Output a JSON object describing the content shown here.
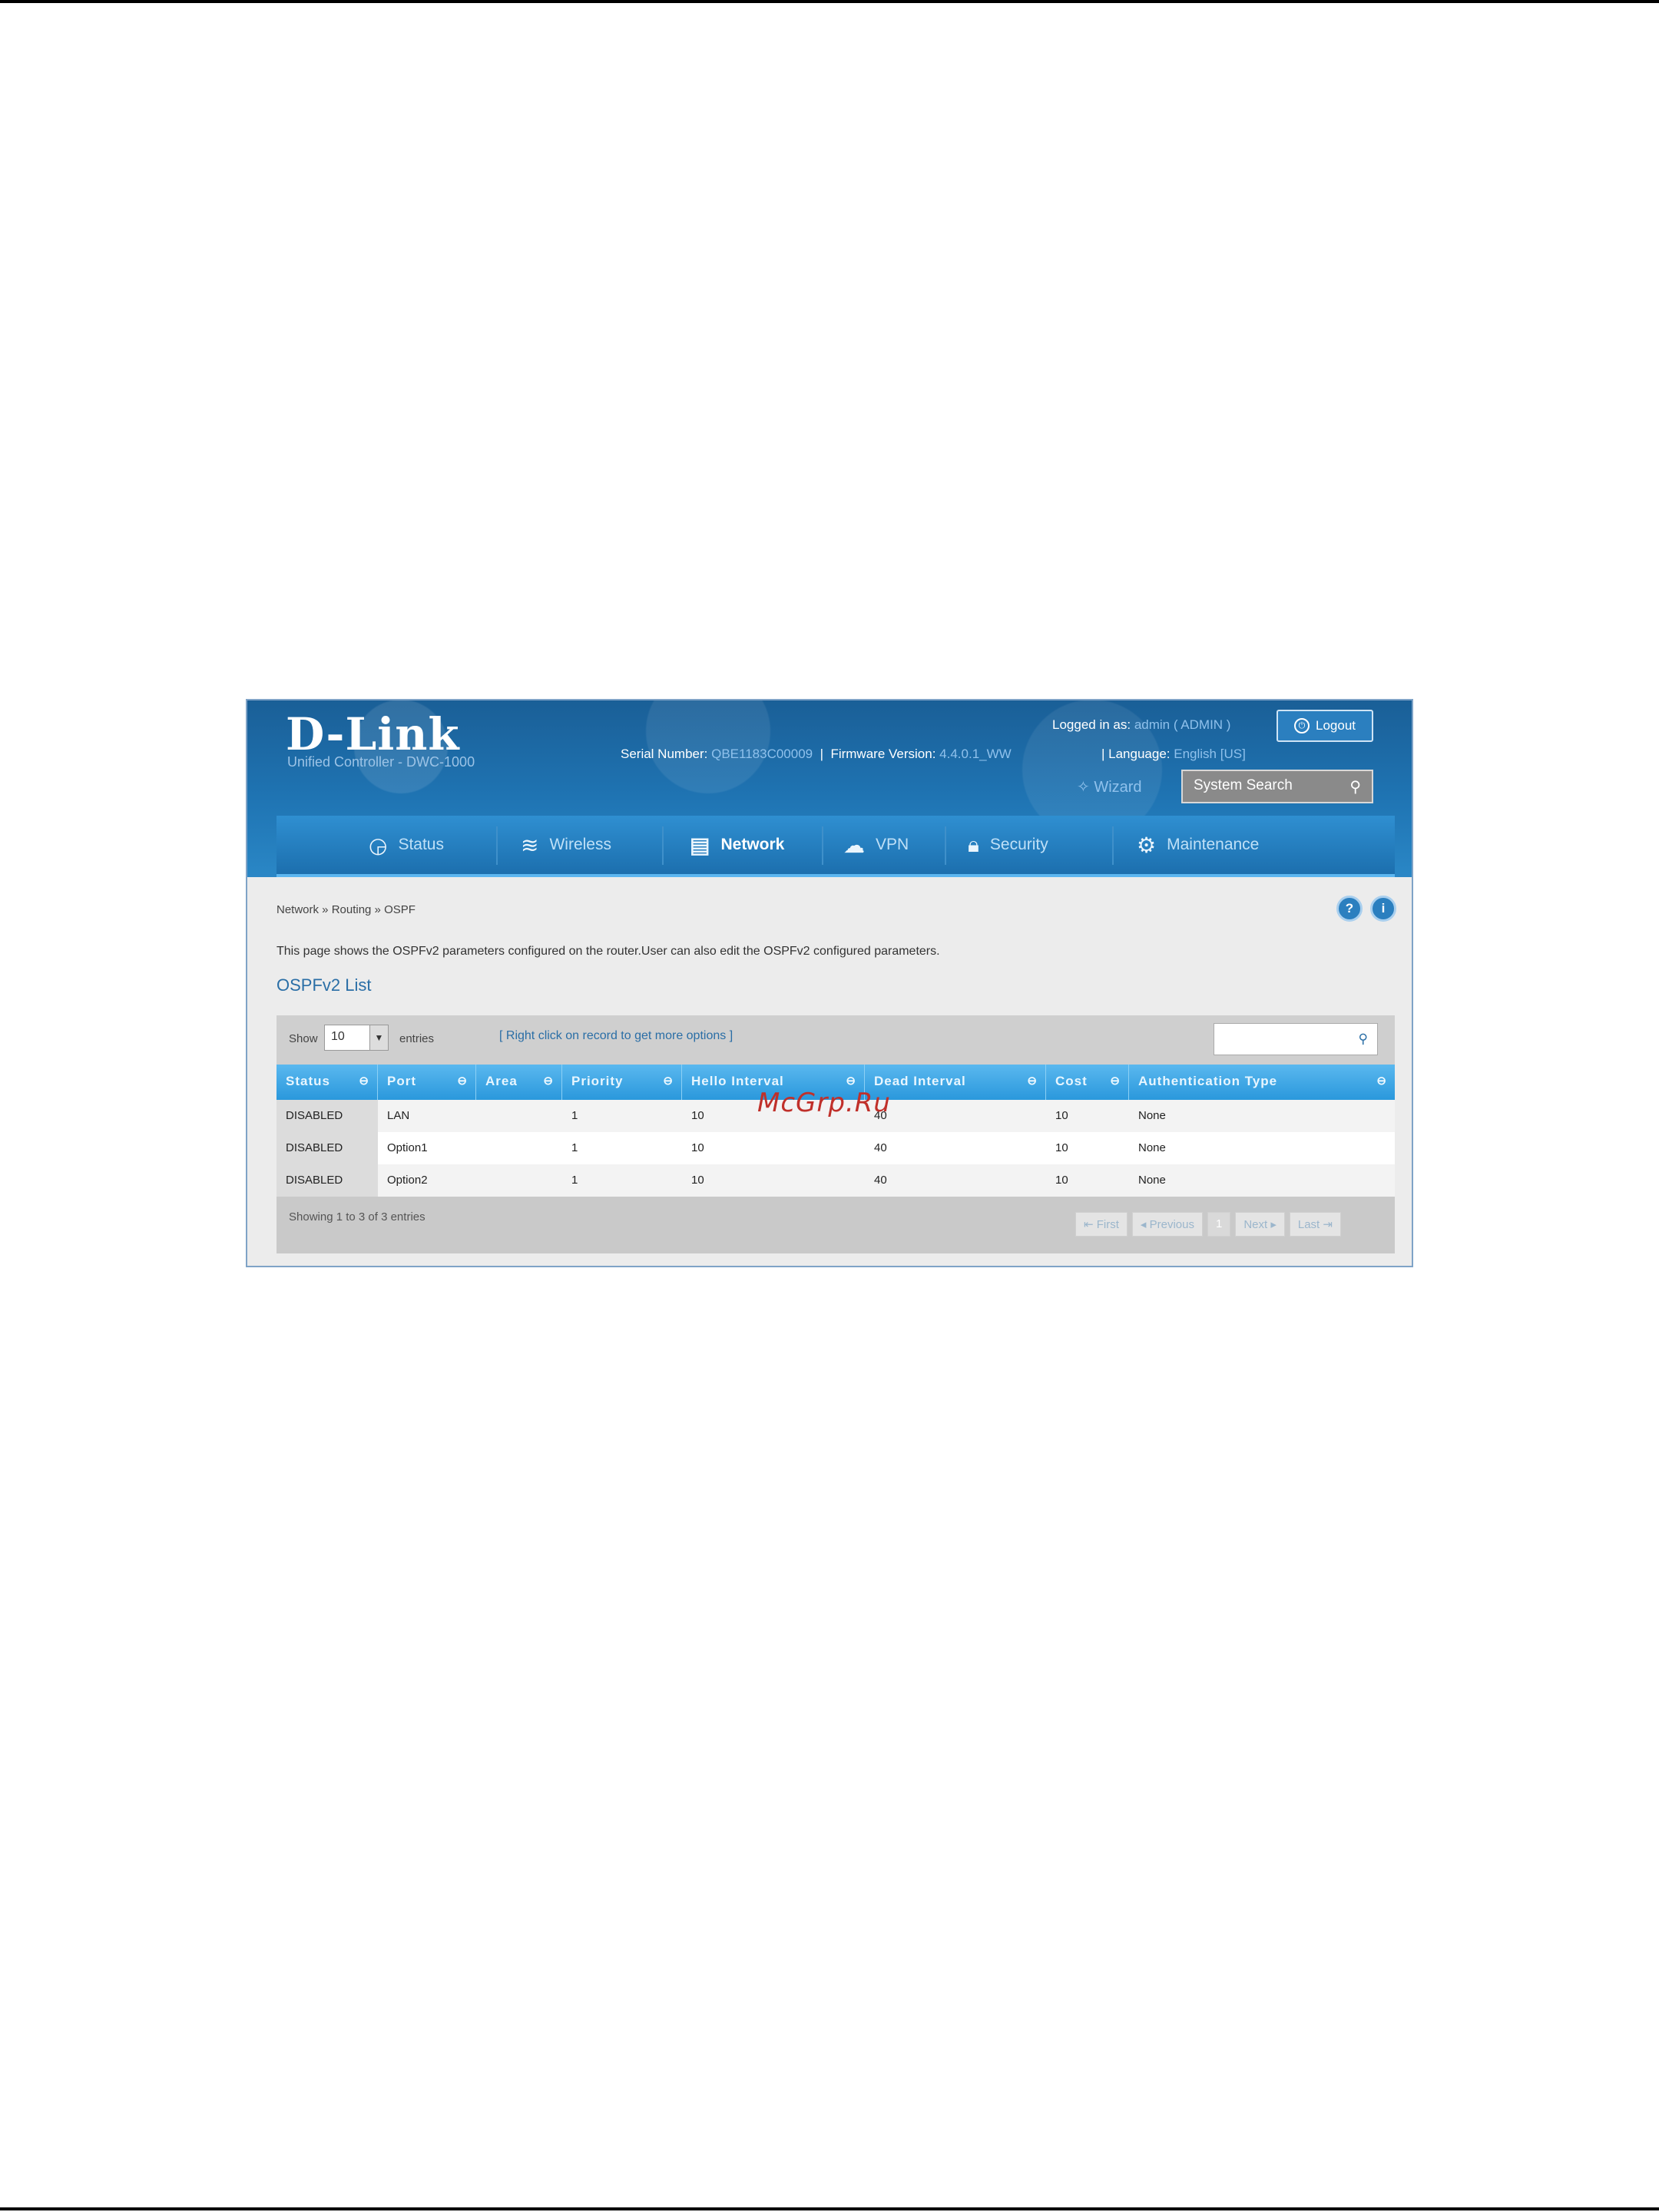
{
  "watermark": "McGrp.Ru",
  "header": {
    "brand": "D-Link",
    "subtitle": "Unified Controller - DWC-1000",
    "serial_label": "Serial Number:",
    "serial_value": "QBE1183C00009",
    "firmware_label": "Firmware Version:",
    "firmware_value": "4.4.0.1_WW",
    "logged_in_label": "Logged in as:",
    "logged_in_value": "admin ( ADMIN )",
    "language_label": "Language:",
    "language_value": "English [US]",
    "logout_label": "Logout",
    "wizard_label": "Wizard",
    "system_search_placeholder": "System Search"
  },
  "nav": {
    "items": [
      {
        "label": "Status",
        "icon": "gauge-icon",
        "active": false
      },
      {
        "label": "Wireless",
        "icon": "wifi-icon",
        "active": false
      },
      {
        "label": "Network",
        "icon": "network-icon",
        "active": true
      },
      {
        "label": "VPN",
        "icon": "cloud-icon",
        "active": false
      },
      {
        "label": "Security",
        "icon": "lock-icon",
        "active": false
      },
      {
        "label": "Maintenance",
        "icon": "gears-icon",
        "active": false
      }
    ]
  },
  "breadcrumb": "Network  »  Routing  »  OSPF",
  "description": "This page shows the OSPFv2 parameters configured on the router.User can also edit the OSPFv2 configured parameters.",
  "list_title": "OSPFv2 List",
  "table": {
    "show_label": "Show",
    "show_value": "10",
    "entries_label": "entries",
    "right_click_hint": "[ Right click on record to get more options ]",
    "columns": [
      "Status",
      "Port",
      "Area",
      "Priority",
      "Hello Interval",
      "Dead Interval",
      "Cost",
      "Authentication Type"
    ],
    "rows": [
      [
        "DISABLED",
        "LAN",
        "",
        "1",
        "10",
        "40",
        "10",
        "None"
      ],
      [
        "DISABLED",
        "Option1",
        "",
        "1",
        "10",
        "40",
        "10",
        "None"
      ],
      [
        "DISABLED",
        "Option2",
        "",
        "1",
        "10",
        "40",
        "10",
        "None"
      ]
    ],
    "showing_text": "Showing 1 to 3 of 3 entries",
    "pager": {
      "first": "First",
      "previous": "Previous",
      "current": "1",
      "next": "Next",
      "last": "Last"
    }
  }
}
